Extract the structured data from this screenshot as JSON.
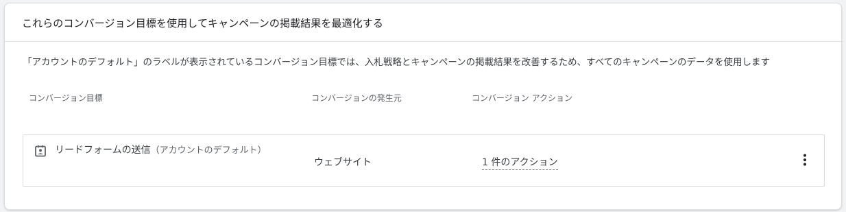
{
  "card": {
    "title": "これらのコンバージョン目標を使用してキャンペーンの掲載結果を最適化する",
    "description": "「アカウントのデフォルト」のラベルが表示されているコンバージョン目標では、入札戦略とキャンペーンの掲載結果を改善するため、すべてのキャンペーンのデータを使用します"
  },
  "table": {
    "headers": {
      "goal": "コンバージョン目標",
      "source": "コンバージョンの発生元",
      "action": "コンバージョン アクション"
    },
    "rows": [
      {
        "icon": "lead-form-icon",
        "goal": "リードフォームの送信",
        "goal_label": "（アカウントのデフォルト）",
        "source": "ウェブサイト",
        "actions": "1 件のアクション",
        "menu_icon": "more-vert-icon"
      }
    ]
  },
  "colors": {
    "border": "#dadce0",
    "text": "#3c4043",
    "muted": "#5f6368"
  }
}
